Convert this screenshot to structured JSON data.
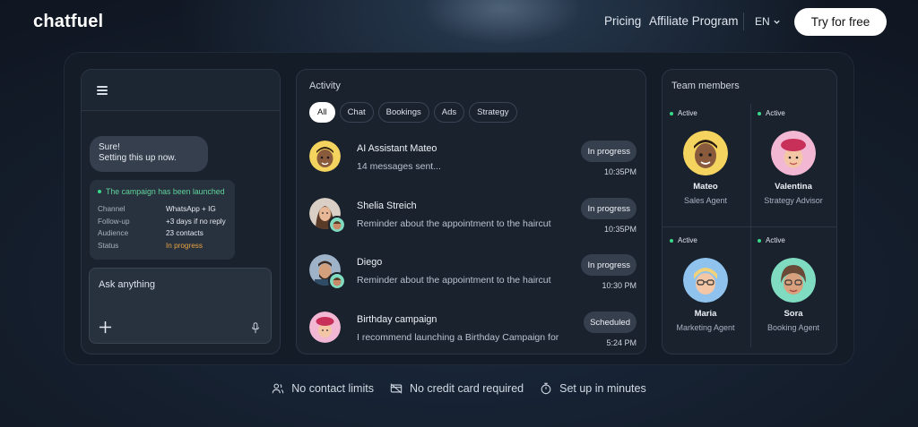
{
  "header": {
    "logo": "chatfuel",
    "nav": {
      "pricing": "Pricing",
      "affiliate": "Affiliate Program",
      "lang": "EN"
    },
    "cta": "Try for free"
  },
  "chat": {
    "bubble_line1": "Sure!",
    "bubble_line2": "Setting this up now.",
    "campaign": {
      "title": "The campaign has been launched",
      "rows": [
        {
          "k": "Channel",
          "v": "WhatsApp + IG"
        },
        {
          "k": "Follow-up",
          "v": "+3 days if no reply"
        },
        {
          "k": "Audience",
          "v": "23 contacts"
        },
        {
          "k": "Status",
          "v": "In progress"
        }
      ]
    },
    "input_placeholder": "Ask anything"
  },
  "activity": {
    "title": "Activity",
    "filters": [
      "All",
      "Chat",
      "Bookings",
      "Ads",
      "Strategy"
    ],
    "active_filter": "All",
    "items": [
      {
        "name": "AI Assistant Mateo",
        "message": "14 messages sent...",
        "status": "In progress",
        "time": "10:35PM"
      },
      {
        "name": "Shelia Streich",
        "message": "Reminder about the appointment to the haircut",
        "status": "In progress",
        "time": "10:35PM"
      },
      {
        "name": "Diego",
        "message": "Reminder about the appointment to the haircut",
        "status": "In progress",
        "time": "10:30 PM"
      },
      {
        "name": "Birthday campaign",
        "message": "I recommend launching a Birthday Campaign for",
        "status": "Scheduled",
        "time": "5:24 PM"
      }
    ]
  },
  "team": {
    "title": "Team members",
    "members": [
      {
        "status": "Active",
        "name": "Mateo",
        "role": "Sales Agent"
      },
      {
        "status": "Active",
        "name": "Valentina",
        "role": "Strategy Advisor"
      },
      {
        "status": "Active",
        "name": "Maria",
        "role": "Marketing Agent"
      },
      {
        "status": "Active",
        "name": "Sora",
        "role": "Booking Agent"
      }
    ]
  },
  "footer": {
    "features": [
      "No contact limits",
      "No credit card required",
      "Set up in minutes"
    ]
  },
  "colors": {
    "active_dot": "#39d98a",
    "status_orange": "#e9a441",
    "cta_bg": "#ffffff"
  }
}
